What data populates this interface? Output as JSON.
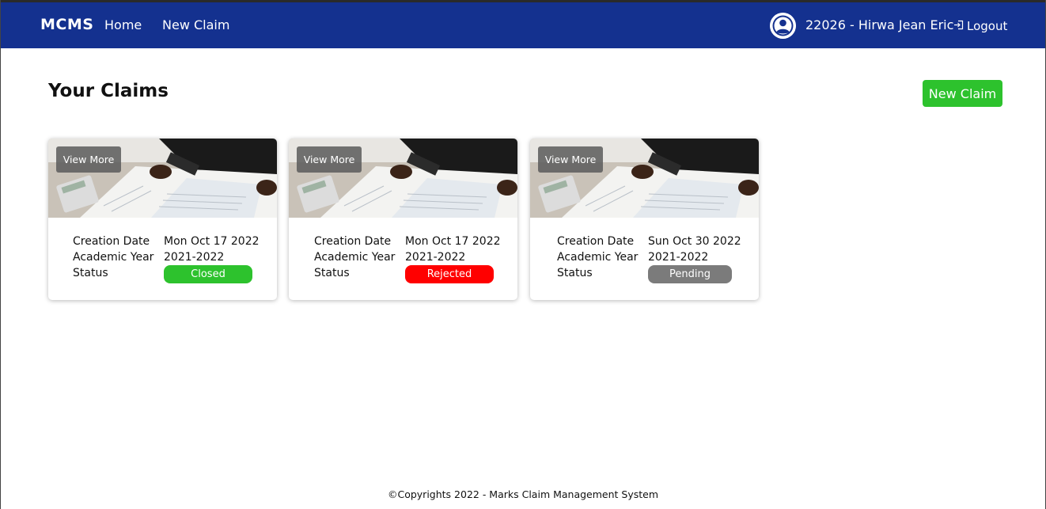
{
  "navbar": {
    "brand": "MCMS",
    "links": [
      "Home",
      "New Claim"
    ],
    "user": "22026 - Hirwa Jean Eric",
    "logout": "Logout"
  },
  "main": {
    "title": "Your Claims",
    "new_claim_button": "New Claim",
    "labels": {
      "creation_date": "Creation Date",
      "academic_year": "Academic Year",
      "status": "Status"
    },
    "view_more": "View More",
    "claims": [
      {
        "creation_date": "Mon Oct 17 2022",
        "academic_year": "2021-2022",
        "status": "Closed",
        "status_color": "#2dc22d"
      },
      {
        "creation_date": "Mon Oct 17 2022",
        "academic_year": "2021-2022",
        "status": "Rejected",
        "status_color": "#ff0000"
      },
      {
        "creation_date": "Sun Oct 30 2022",
        "academic_year": "2021-2022",
        "status": "Pending",
        "status_color": "#7b7b7b"
      }
    ]
  },
  "footer": "©Copyrights 2022 - Marks Claim Management System",
  "colors": {
    "navbar": "#14318f",
    "accent": "#2dc22d"
  }
}
